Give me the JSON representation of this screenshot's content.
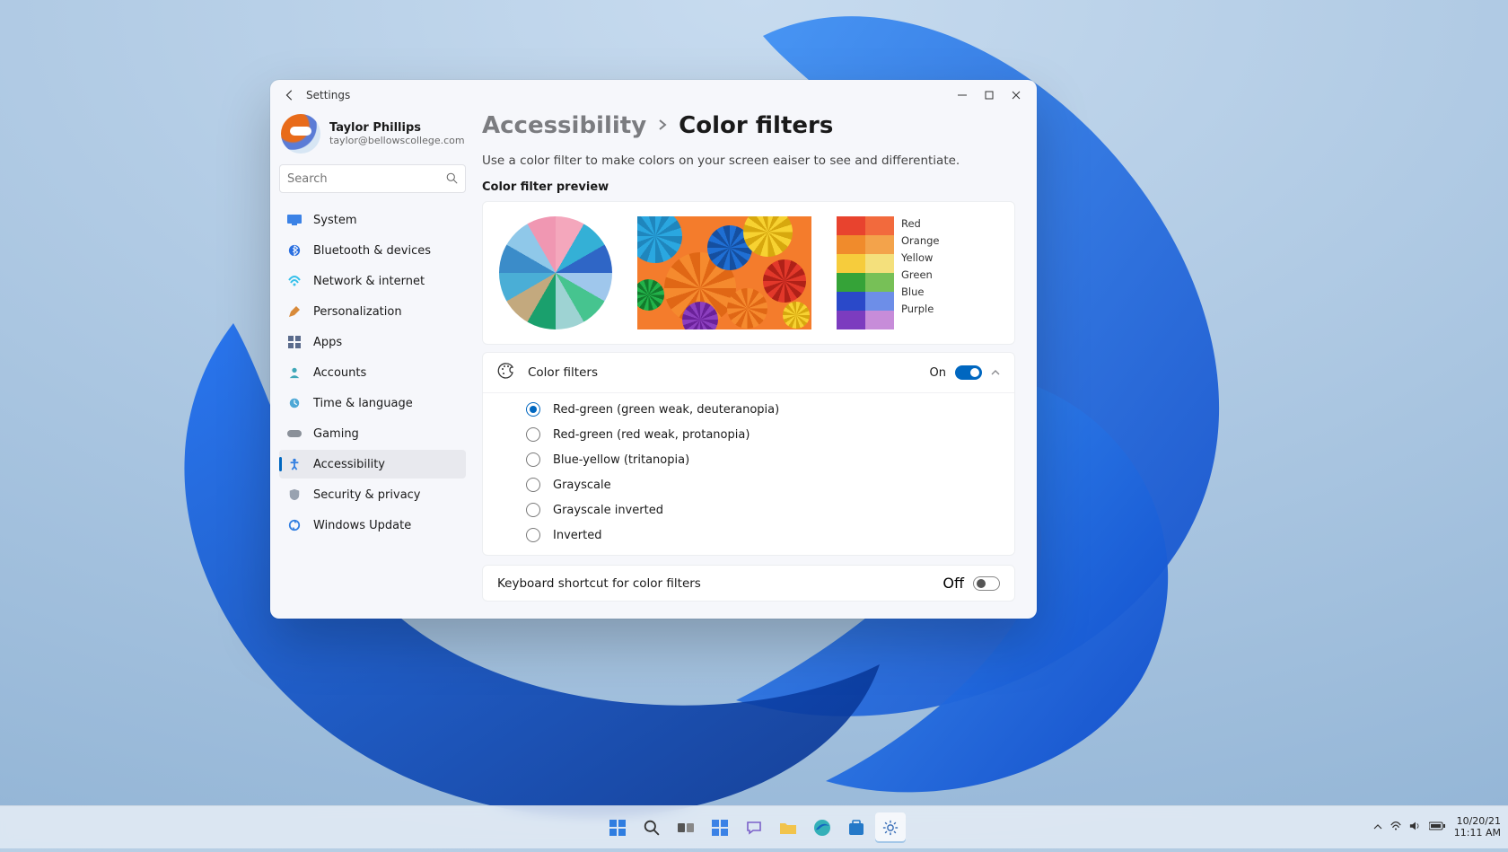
{
  "window": {
    "app_title": "Settings",
    "user": {
      "name": "Taylor Phillips",
      "email": "taylor@bellowscollege.com"
    },
    "search_placeholder": "Search"
  },
  "sidebar": {
    "items": [
      {
        "label": "System"
      },
      {
        "label": "Bluetooth & devices"
      },
      {
        "label": "Network & internet"
      },
      {
        "label": "Personalization"
      },
      {
        "label": "Apps"
      },
      {
        "label": "Accounts"
      },
      {
        "label": "Time & language"
      },
      {
        "label": "Gaming"
      },
      {
        "label": "Accessibility",
        "active": true
      },
      {
        "label": "Security & privacy"
      },
      {
        "label": "Windows Update"
      }
    ]
  },
  "breadcrumb": {
    "parent": "Accessibility",
    "current": "Color filters"
  },
  "description": "Use a color filter to make colors on your screen eaiser to see and differentiate.",
  "preview_label": "Color filter preview",
  "palette": {
    "rows": [
      {
        "label": "Red",
        "c1": "#e8432e",
        "c2": "#f26a3d"
      },
      {
        "label": "Orange",
        "c1": "#f08b2c",
        "c2": "#f3a34b"
      },
      {
        "label": "Yellow",
        "c1": "#f6cc3c",
        "c2": "#f4e07c"
      },
      {
        "label": "Green",
        "c1": "#35a338",
        "c2": "#77c057"
      },
      {
        "label": "Blue",
        "c1": "#2a49c9",
        "c2": "#6d8ee8"
      },
      {
        "label": "Purple",
        "c1": "#7c3cbf",
        "c2": "#c78cd9"
      }
    ]
  },
  "color_filters": {
    "title": "Color filters",
    "state_label": "On",
    "enabled": true,
    "options": [
      "Red-green (green weak, deuteranopia)",
      "Red-green (red weak, protanopia)",
      "Blue-yellow (tritanopia)",
      "Grayscale",
      "Grayscale inverted",
      "Inverted"
    ],
    "selected_index": 0
  },
  "shortcut": {
    "label": "Keyboard shortcut for color filters",
    "state_label": "Off",
    "enabled": false
  },
  "tray": {
    "date": "10/20/21",
    "time": "11:11 AM"
  }
}
